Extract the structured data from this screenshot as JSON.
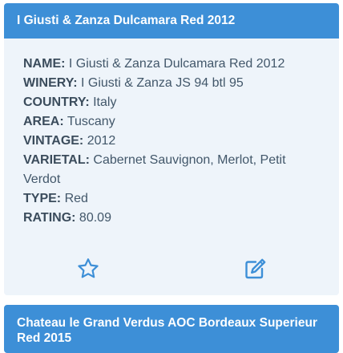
{
  "wines": [
    {
      "title": "I Giusti & Zanza Dulcamara Red 2012",
      "fields": [
        {
          "label": "NAME:",
          "value": "I Giusti & Zanza Dulcamara Red 2012"
        },
        {
          "label": "WINERY:",
          "value": "I Giusti & Zanza JS 94 btl 95"
        },
        {
          "label": "COUNTRY:",
          "value": "Italy"
        },
        {
          "label": "AREA:",
          "value": "Tuscany"
        },
        {
          "label": "VINTAGE:",
          "value": "2012"
        },
        {
          "label": "VARIETAL:",
          "value": "Cabernet Sauvignon, Merlot, Petit Verdot"
        },
        {
          "label": "TYPE:",
          "value": "Red"
        },
        {
          "label": "RATING:",
          "value": "80.09"
        }
      ],
      "actions": {
        "favorite_icon": "star-outline-icon",
        "edit_icon": "edit-icon"
      }
    },
    {
      "title": "Chateau le Grand Verdus AOC Bordeaux Superieur Red 2015"
    }
  ],
  "colors": {
    "header_bg": "#3d8fd7",
    "card_bg": "#eef4fa",
    "icon": "#3d8fd7"
  }
}
